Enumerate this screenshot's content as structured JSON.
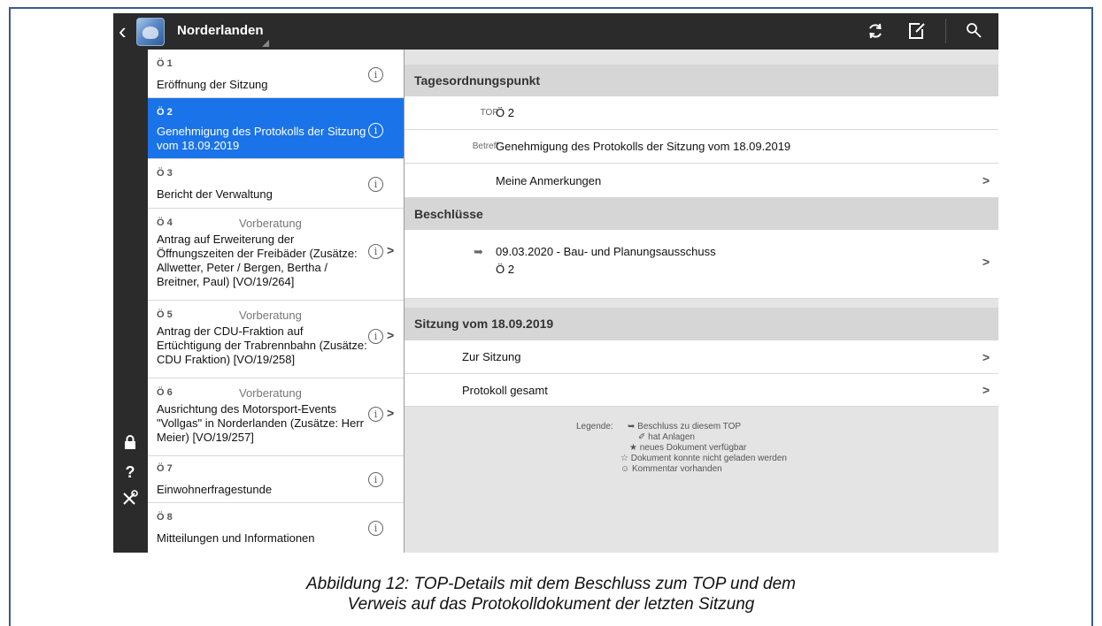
{
  "app": {
    "title": "Norderlanden"
  },
  "agenda": [
    {
      "num": "Ö 1",
      "note": "",
      "title": "Eröffnung der Sitzung",
      "selected": false,
      "chevron": false
    },
    {
      "num": "Ö 2",
      "note": "",
      "title": "Genehmigung des Protokolls der Sitzung vom 18.09.2019",
      "selected": true,
      "chevron": false
    },
    {
      "num": "Ö 3",
      "note": "",
      "title": "Bericht der Verwaltung",
      "selected": false,
      "chevron": false
    },
    {
      "num": "Ö 4",
      "note": "Vorberatung",
      "title": "Antrag auf Erweiterung der Öffnungszeiten der Freibäder (Zusätze: Allwetter, Peter / Bergen, Bertha / Breitner, Paul) [VO/19/264]",
      "selected": false,
      "chevron": true
    },
    {
      "num": "Ö 5",
      "note": "Vorberatung",
      "title": "Antrag der CDU-Fraktion auf Ertüchtigung der Trabrennbahn (Zusätze: CDU Fraktion) [VO/19/258]",
      "selected": false,
      "chevron": true
    },
    {
      "num": "Ö 6",
      "note": "Vorberatung",
      "title": "Ausrichtung des Motorsport-Events \"Vollgas\" in Norderlanden (Zusätze: Herr Meier) [VO/19/257]",
      "selected": false,
      "chevron": true
    },
    {
      "num": "Ö 7",
      "note": "",
      "title": "Einwohnerfragestunde",
      "selected": false,
      "chevron": false
    },
    {
      "num": "Ö 8",
      "note": "",
      "title": "Mitteilungen und Informationen",
      "selected": false,
      "chevron": false
    }
  ],
  "detail": {
    "section_top": "Tagesordnungspunkt",
    "top_label": "TOP",
    "top_value": "Ö 2",
    "betreff_label": "Betreff",
    "betreff_value": "Genehmigung des Protokolls der Sitzung vom 18.09.2019",
    "anmerkungen": "Meine Anmerkungen",
    "section_beschluesse": "Beschlüsse",
    "beschluss_line1": "09.03.2020 - Bau- und Planungsausschuss",
    "beschluss_line2": "Ö 2",
    "section_sitzung": "Sitzung vom 18.09.2019",
    "zur_sitzung": "Zur Sitzung",
    "protokoll": "Protokoll gesamt"
  },
  "legend": {
    "label": "Legende:",
    "lines": [
      "➥ Beschluss zu diesem TOP",
      "✐ hat Anlagen",
      "★ neues Dokument verfügbar",
      "☆ Dokument konnte nicht geladen werden",
      "☺ Kommentar vorhanden"
    ]
  },
  "caption": {
    "line1": "Abbildung 12: TOP-Details mit dem Beschluss zum TOP und dem",
    "line2": "Verweis auf das Protokolldokument der letzten Sitzung"
  },
  "colors": {
    "selection": "#1a73e8",
    "topbar": "#2b2b2b",
    "frame": "#3a5a8c"
  },
  "icons": [
    "back-chevron-icon",
    "app-logo",
    "refresh-icon",
    "edit-icon",
    "search-icon",
    "lock-icon",
    "help-icon",
    "tools-icon",
    "info-icon",
    "chevron-right-icon",
    "beschluss-arrow-icon"
  ]
}
